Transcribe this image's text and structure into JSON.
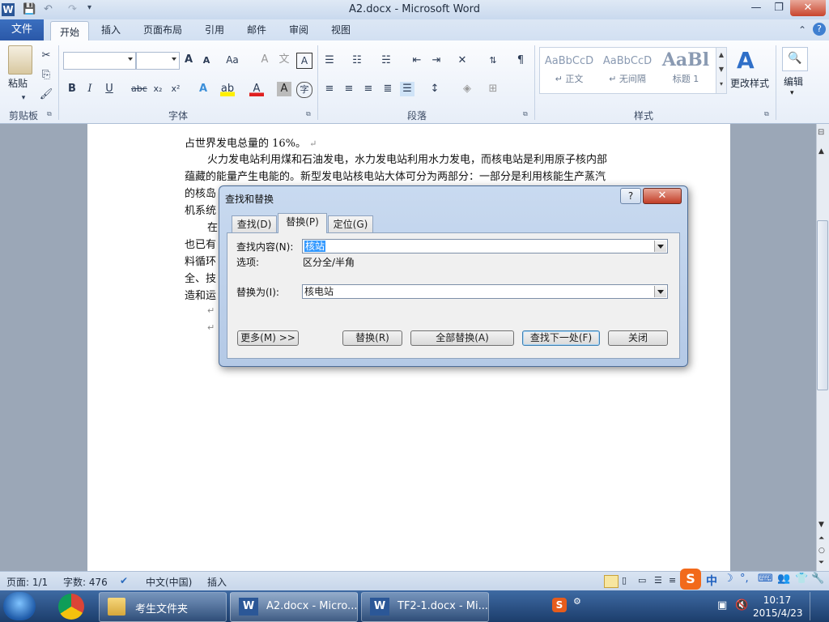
{
  "window": {
    "title": "A2.docx - Microsoft Word"
  },
  "ribbon": {
    "file_tab": "文件",
    "tabs": [
      "开始",
      "插入",
      "页面布局",
      "引用",
      "邮件",
      "审阅",
      "视图"
    ],
    "clipboard": {
      "paste_label": "粘贴",
      "group_label": "剪贴板"
    },
    "font": {
      "group_label": "字体",
      "font_name": "",
      "font_size": ""
    },
    "paragraph": {
      "group_label": "段落"
    },
    "styles": {
      "group_label": "样式",
      "items": [
        {
          "sample": "AaBbCcD",
          "name": "↵ 正文"
        },
        {
          "sample": "AaBbCcD",
          "name": "↵ 无间隔"
        },
        {
          "sample": "AaBl",
          "name": "标题 1"
        }
      ],
      "change_styles_label": "更改样式"
    },
    "editing": {
      "label": "编辑"
    }
  },
  "document": {
    "lines": [
      "占世界发电总量的 16%。",
      "火力发电站利用煤和石油发电，水力发电站利用水力发电，而核电站是利用原子核内部",
      "蕴藏的能量产生电能的。新型发电站核电站大体可分为两部分：一部分是利用核能生产蒸汽",
      "的核岛",
      "机系统",
      "在",
      "也已有",
      "料循环",
      "全、技",
      "造和运"
    ],
    "para_mark": "↵"
  },
  "dialog": {
    "title": "查找和替换",
    "help_label": "?",
    "close_label": "✕",
    "tabs": [
      "查找(D)",
      "替换(P)",
      "定位(G)"
    ],
    "find_label": "查找内容(N):",
    "find_value": "核站",
    "options_label": "选项:",
    "options_value": "区分全/半角",
    "replace_label": "替换为(I):",
    "replace_value": "核电站",
    "buttons": {
      "more": "更多(M) >>",
      "replace": "替换(R)",
      "replace_all": "全部替换(A)",
      "find_next": "查找下一处(F)",
      "close": "关闭"
    }
  },
  "statusbar": {
    "page": "页面: 1/1",
    "words": "字数: 476",
    "language": "中文(中国)",
    "mode": "插入"
  },
  "taskbar": {
    "items": [
      "考生文件夹",
      "A2.docx - Micro...",
      "TF2-1.docx - Mi..."
    ],
    "time": "10:17",
    "date": "2015/4/23",
    "ime": "中"
  }
}
